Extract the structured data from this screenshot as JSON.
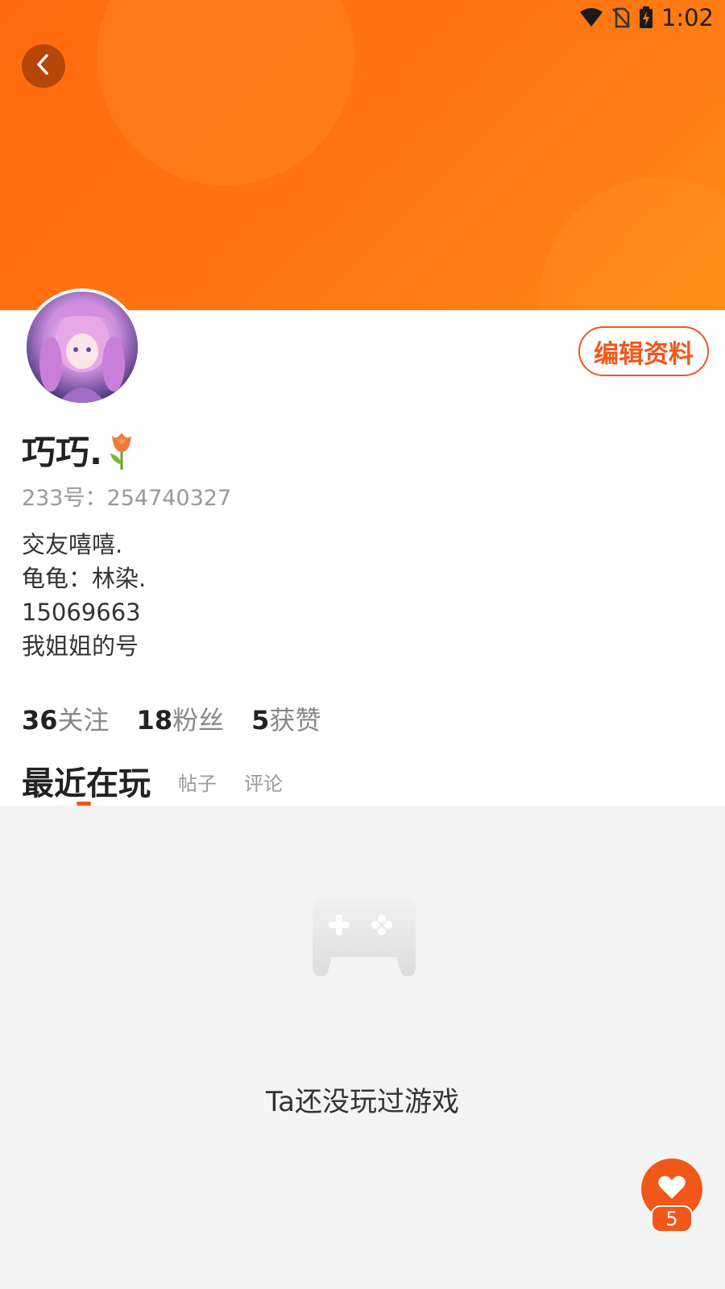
{
  "status_bar": {
    "time": "1:02",
    "icons": [
      "wifi-icon",
      "no-sim-icon",
      "battery-charging-icon"
    ]
  },
  "header": {
    "back_icon": "chevron-left-icon",
    "gradient_colors": [
      "#ff6a10",
      "#ff8a12"
    ]
  },
  "profile": {
    "edit_button_label": "编辑资料",
    "nickname": "巧巧.",
    "nickname_emoji": "tulip-icon",
    "uid_text": "233号：254740327",
    "bio_lines": [
      "交友嘻嘻.",
      "龟龟：林染.",
      "15069663",
      "我姐姐的号"
    ],
    "stats": [
      {
        "value": "36",
        "label": "关注"
      },
      {
        "value": "18",
        "label": "粉丝"
      },
      {
        "value": "5",
        "label": "获赞"
      }
    ]
  },
  "tabs": [
    {
      "label": "最近在玩",
      "active": true
    },
    {
      "label": "帖子",
      "active": false
    },
    {
      "label": "评论",
      "active": false
    }
  ],
  "empty_state": {
    "icon": "gamepad-icon",
    "message": "Ta还没玩过游戏"
  },
  "like_fab": {
    "icon": "heart-icon",
    "count": "5"
  },
  "colors": {
    "accent": "#f2571a",
    "page_background": "#f4f4f4"
  }
}
